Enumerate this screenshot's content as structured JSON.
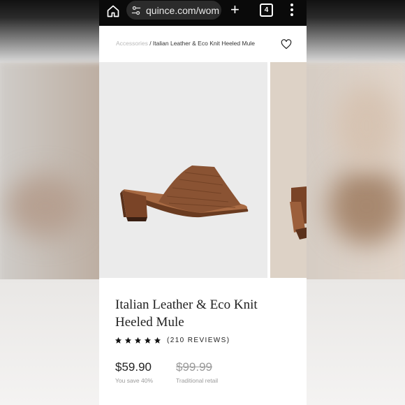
{
  "browser": {
    "url": "quince.com/wom",
    "tab_count": "4",
    "icons": [
      "home-icon",
      "tune-icon",
      "plus-icon",
      "tab-switcher-icon",
      "more-vert-icon"
    ]
  },
  "breadcrumb": {
    "parent": "Accessories",
    "separator": " / ",
    "current": "Italian Leather & Eco Knit Heeled Mule"
  },
  "product": {
    "title": "Italian Leather & Eco Knit Heeled Mule",
    "rating_stars": 5,
    "reviews_label": "(210 REVIEWS)",
    "price": "$59.90",
    "savings": "You save 40%",
    "retail_price": "$99.99",
    "retail_label": "Traditional retail"
  },
  "colors": {
    "leather": "#8a5333",
    "accent_dark": "#222222"
  }
}
